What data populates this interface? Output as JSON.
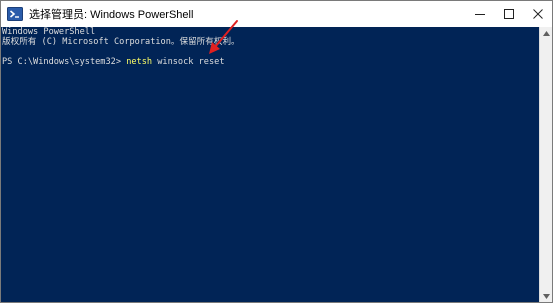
{
  "window": {
    "title": "选择管理员: Windows PowerShell",
    "controls": {
      "minimize_icon": "minimize-icon",
      "maximize_icon": "maximize-icon",
      "close_icon": "close-icon"
    },
    "app_icon": "powershell-icon"
  },
  "console": {
    "banner_line1": "Windows PowerShell",
    "banner_line2": "版权所有 (C) Microsoft Corporation。保留所有权利。",
    "prompt": "PS C:\\Windows\\system32> ",
    "command_keyword": "netsh",
    "command_args": " winsock reset"
  },
  "colors": {
    "console_background": "#012456",
    "console_text": "#dedede",
    "command_keyword": "#ffff66",
    "annotation_arrow": "#e02020"
  }
}
